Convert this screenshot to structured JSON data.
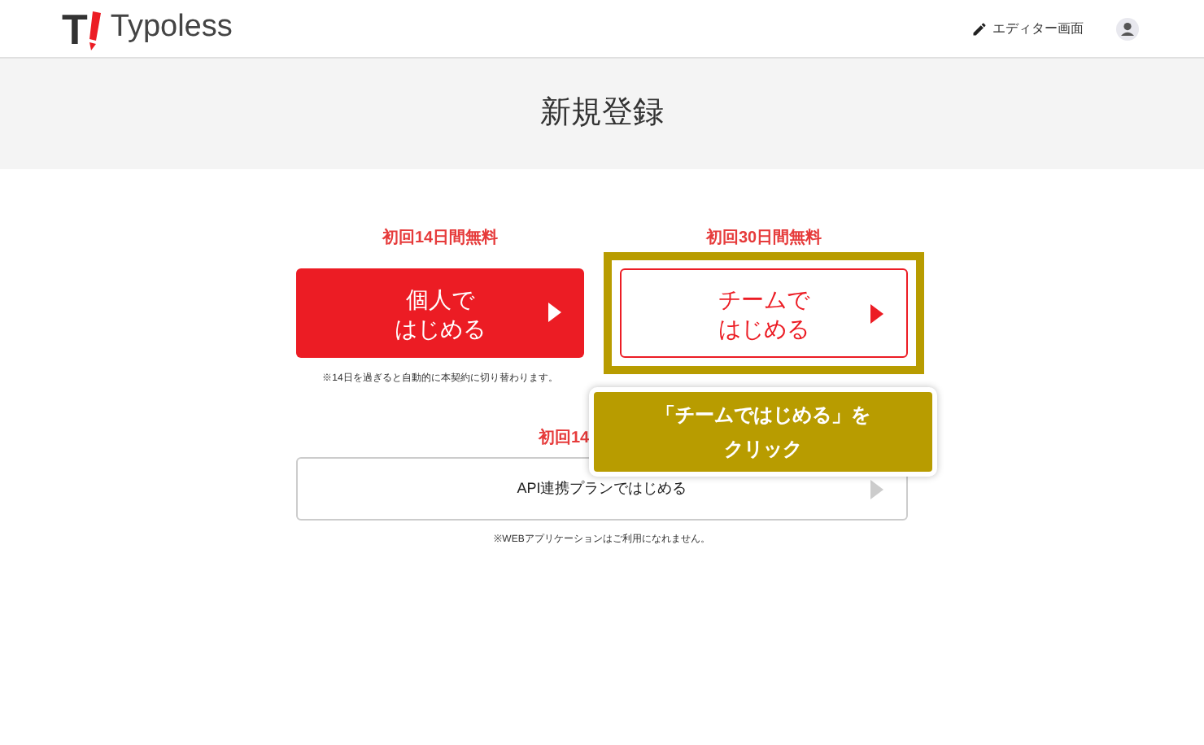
{
  "header": {
    "logo_mark": "T",
    "logo_text": "Typoless",
    "editor_link": "エディター画面"
  },
  "page_title": "新規登録",
  "plans": [
    {
      "badge": "初回14日間無料",
      "line1": "個人で",
      "line2": "はじめる",
      "kind": "filled",
      "highlighted": false,
      "note": "※14日を過ぎると自動的に本契約に切り替わります。"
    },
    {
      "badge": "初回30日間無料",
      "line1": "チームで",
      "line2": "はじめる",
      "kind": "outlined",
      "highlighted": true
    }
  ],
  "api_plan": {
    "badge": "初回14",
    "label": "API連携プランではじめる",
    "note": "※WEBアプリケーションはご利用になれません。"
  },
  "callout": {
    "line1": "「チームではじめる」を",
    "line2": "クリック"
  }
}
